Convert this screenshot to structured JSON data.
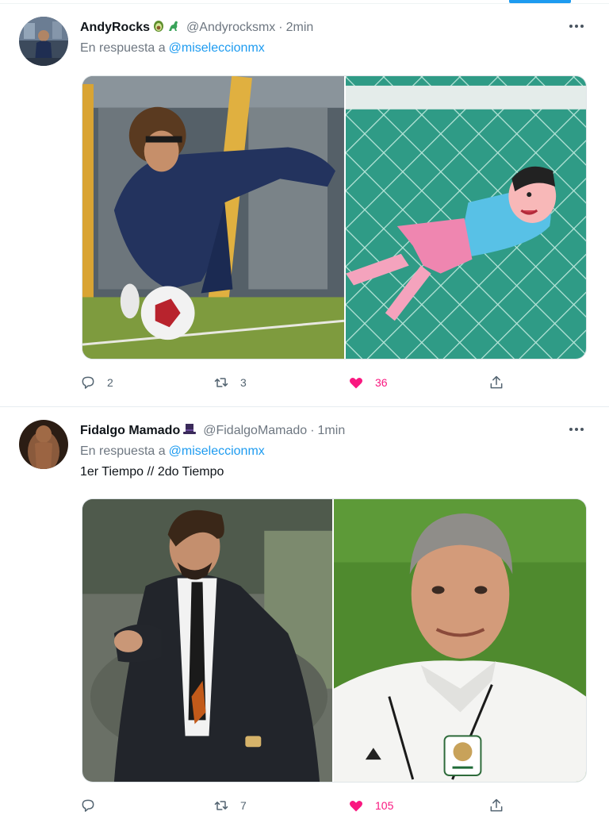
{
  "colors": {
    "accent": "#1d9bf0",
    "like": "#f91880",
    "muted": "#6e7781"
  },
  "tweets": [
    {
      "display_name": "AndyRocks",
      "emoji": [
        "avocado-emoji",
        "dinosaur-emoji"
      ],
      "handle": "@Andyrocksmx",
      "time": "2min",
      "reply_prefix": "En respuesta a",
      "reply_to": "@miseleccionmx",
      "text": "",
      "media": [
        "goalkeeper-diving-photo",
        "cartoon-goalkeeper-drawing"
      ],
      "replies": "2",
      "retweets": "3",
      "likes": "36"
    },
    {
      "display_name": "Fidalgo Mamado",
      "emoji": [
        "top-hat-emoji"
      ],
      "handle": "@FidalgoMamado",
      "time": "1min",
      "reply_prefix": "En respuesta a",
      "reply_to": "@miseleccionmx",
      "text": "1er Tiempo // 2do Tiempo",
      "media": [
        "coach-in-suit-photo",
        "coach-in-white-jacket-photo"
      ],
      "replies": "",
      "retweets": "7",
      "likes": "105"
    }
  ]
}
